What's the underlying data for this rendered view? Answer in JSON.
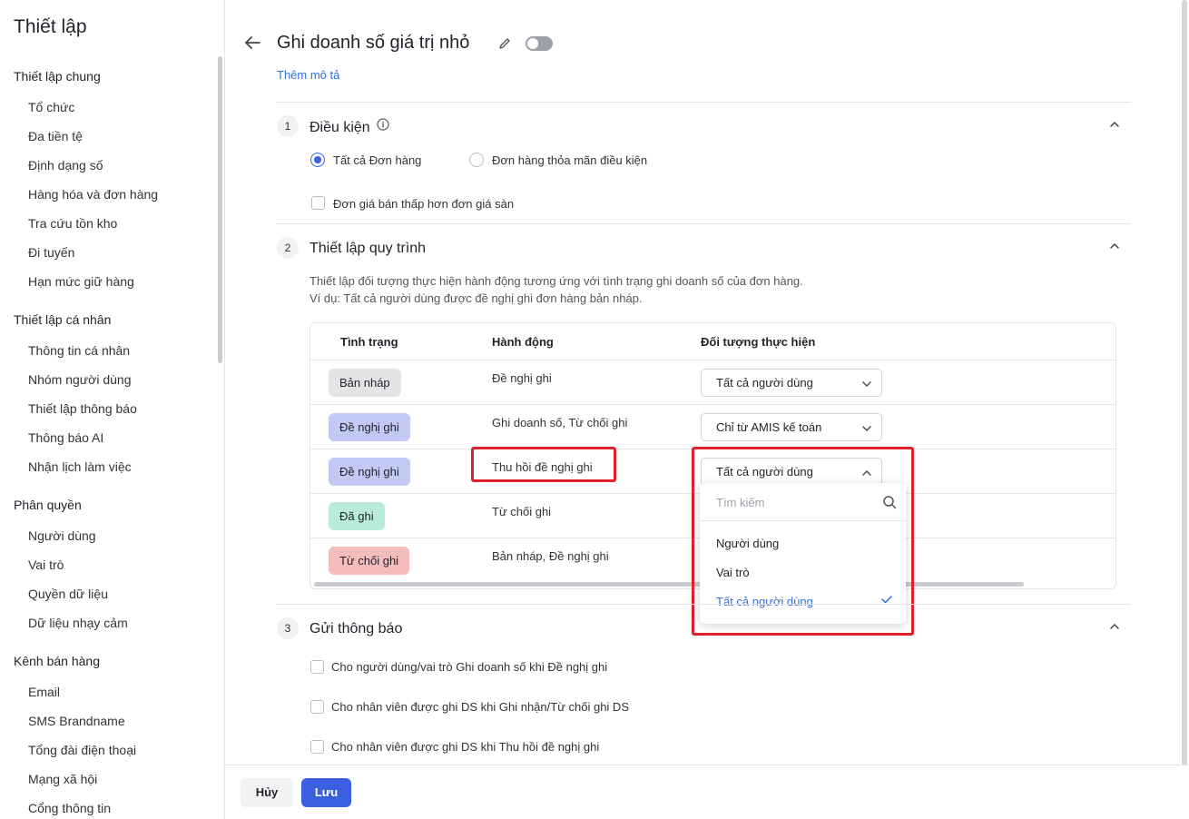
{
  "sidebar": {
    "title": "Thiết lập",
    "groups": [
      {
        "label": "Thiết lập chung",
        "items": [
          "Tổ chức",
          "Đa tiền tệ",
          "Định dạng số",
          "Hàng hóa và đơn hàng",
          "Tra cứu tồn kho",
          "Đi tuyến",
          "Hạn mức giữ hàng"
        ]
      },
      {
        "label": "Thiết lập cá nhân",
        "items": [
          "Thông tin cá nhân",
          "Nhóm người dùng",
          "Thiết lập thông báo",
          "Thông báo AI",
          "Nhận lịch làm việc"
        ]
      },
      {
        "label": "Phân quyền",
        "items": [
          "Người dùng",
          "Vai trò",
          "Quyền dữ liệu",
          "Dữ liệu nhạy cảm"
        ]
      },
      {
        "label": "Kênh bán hàng",
        "items": [
          "Email",
          "SMS Brandname",
          "Tổng đài điện thoại",
          "Mạng xã hội",
          "Cổng thông tin"
        ]
      }
    ]
  },
  "header": {
    "title": "Ghi doanh số giá trị nhỏ",
    "add_description": "Thêm mô tả"
  },
  "section1": {
    "number": "1",
    "title": "Điều kiện",
    "radio_all": "Tất cả Đơn hàng",
    "radio_condition": "Đơn hàng thỏa mãn điều kiện",
    "checkbox_price": "Đơn giá bán thấp hơn đơn giá sàn"
  },
  "section2": {
    "number": "2",
    "title": "Thiết lập quy trình",
    "desc_line1": "Thiết lập đối tượng thực hiện hành động tương ứng với tình trạng ghi doanh số của đơn hàng.",
    "desc_line2": "Ví dụ: Tất cả người dùng được đề nghị ghi đơn hàng bản nháp.",
    "columns": [
      "Tình trạng",
      "Hành động",
      "Đối tượng thực hiện"
    ],
    "rows": [
      {
        "status": "Bản nháp",
        "status_color": "#e3e4e6",
        "action": "Đề nghị ghi",
        "target": "Tất cả người dùng"
      },
      {
        "status": "Đề nghị ghi",
        "status_color": "#c3c9f5",
        "action": "Ghi doanh số, Từ chối ghi",
        "target": "Chỉ từ AMIS kế toán"
      },
      {
        "status": "Đề nghị ghi",
        "status_color": "#c3c9f5",
        "action": "Thu hồi đề nghị ghi",
        "target": "Tất cả người dùng"
      },
      {
        "status": "Đã ghi",
        "status_color": "#b8ecd9",
        "action": "Từ chối ghi",
        "target": ""
      },
      {
        "status": "Từ chối ghi",
        "status_color": "#f5bcbc",
        "action": "Bản nháp, Đề nghị ghi",
        "target": ""
      }
    ],
    "dropdown": {
      "search_placeholder": "Tìm kiếm",
      "options": [
        "Người dùng",
        "Vai trò",
        "Tất cả người dùng"
      ],
      "selected": "Tất cả người dùng"
    }
  },
  "section3": {
    "number": "3",
    "title": "Gửi thông báo",
    "options": [
      "Cho người dùng/vai trò Ghi doanh số khi Đề nghị ghi",
      "Cho nhân viên được ghi DS khi Ghi nhận/Từ chối ghi DS",
      "Cho nhân viên được ghi DS khi Thu hồi đề nghị ghi"
    ]
  },
  "footer": {
    "cancel": "Hủy",
    "save": "Lưu"
  },
  "colors": {
    "accent": "#3b5fe0",
    "link": "#2f6fd6",
    "highlight": "#e0202a"
  }
}
